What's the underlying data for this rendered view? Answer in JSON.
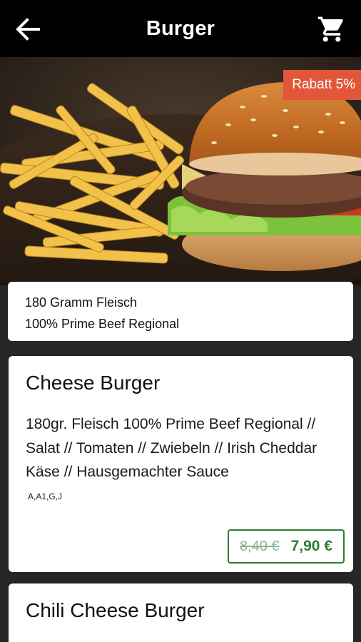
{
  "header": {
    "title": "Burger",
    "back_icon": "arrow-back-icon",
    "cart_icon": "shopping-cart-icon"
  },
  "hero": {
    "discount_badge": "Rabatt 5%",
    "badge_color": "#e2573a"
  },
  "info": {
    "line1": "180 Gramm Fleisch",
    "line2": "100% Prime Beef Regional"
  },
  "products": [
    {
      "name": "Cheese Burger",
      "description": "180gr. Fleisch 100% Prime Beef Regional // Salat // Tomaten // Zwiebeln // Irish Cheddar Käse // Hausgemachter Sauce",
      "allergens": "A,A1,G,J",
      "old_price": "8,40 €",
      "price": "7,90 €",
      "price_color": "#2e7d32"
    },
    {
      "name": "Chili Cheese Burger"
    }
  ]
}
